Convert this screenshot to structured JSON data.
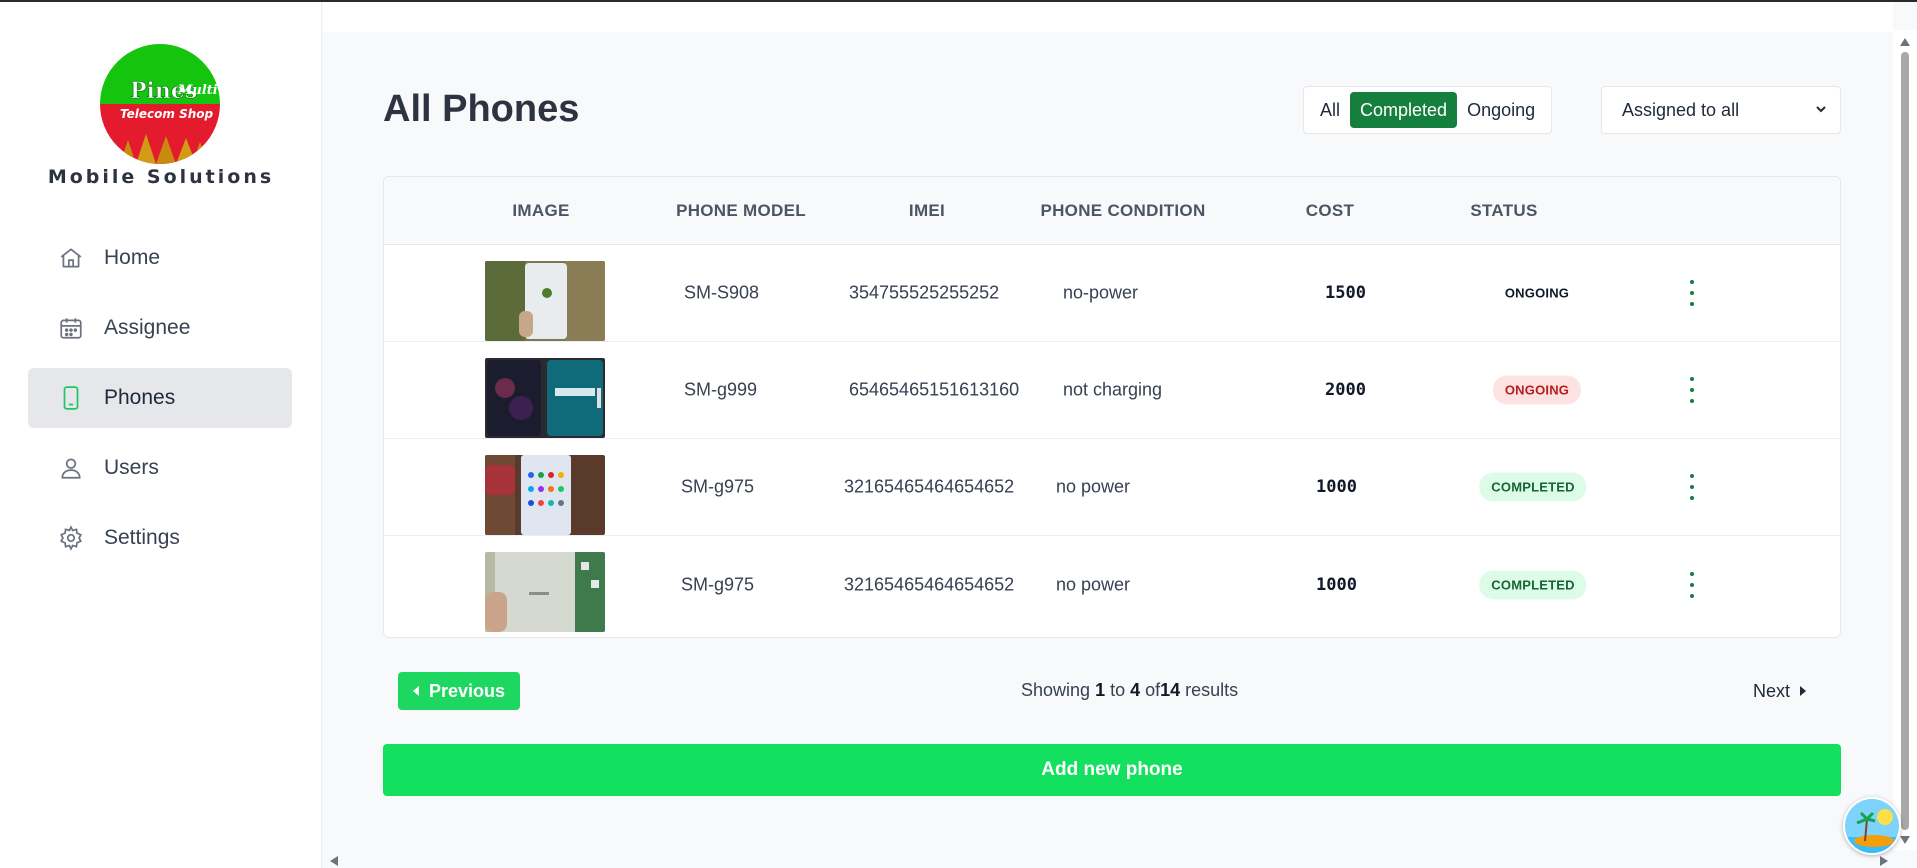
{
  "brand": {
    "logo_text_main": "Pines",
    "logo_text_script": "Multi",
    "logo_text_sub": "Telecom Shop",
    "name": "Mobile Solutions"
  },
  "sidebar": {
    "items": [
      {
        "label": "Home",
        "icon": "home-icon",
        "active": false
      },
      {
        "label": "Assignee",
        "icon": "calendar-icon",
        "active": false
      },
      {
        "label": "Phones",
        "icon": "phone-icon",
        "active": true
      },
      {
        "label": "Users",
        "icon": "user-icon",
        "active": false
      },
      {
        "label": "Settings",
        "icon": "gear-icon",
        "active": false
      }
    ]
  },
  "main": {
    "title": "All Phones",
    "filters": [
      {
        "label": "All",
        "active": false
      },
      {
        "label": "Completed",
        "active": true
      },
      {
        "label": "Ongoing",
        "active": false
      }
    ],
    "assign_select": {
      "selected": "Assigned to all"
    }
  },
  "table": {
    "headers": [
      "IMAGE",
      "PHONE MODEL",
      "IMEI",
      "PHONE CONDITION",
      "COST",
      "STATUS"
    ],
    "rows": [
      {
        "model": "SM-S908",
        "imei": "354755525255252",
        "condition": "no-power",
        "cost": "1500",
        "status": "ONGOING",
        "status_style": "plain"
      },
      {
        "model": "SM-g999",
        "imei": "65465465151613160",
        "condition": "not charging",
        "cost": "2000",
        "status": "ONGOING",
        "status_style": "ongoing"
      },
      {
        "model": "SM-g975",
        "imei": "32165465464654652",
        "condition": "no power",
        "cost": "1000",
        "status": "COMPLETED",
        "status_style": "completed"
      },
      {
        "model": "SM-g975",
        "imei": "32165465464654652",
        "condition": "no power",
        "cost": "1000",
        "status": "COMPLETED",
        "status_style": "completed"
      }
    ]
  },
  "pagination": {
    "previous_label": "Previous",
    "next_label": "Next",
    "showing_prefix": "Showing ",
    "from": "1",
    "to_word": " to ",
    "to": "4",
    "of_word": " of",
    "total": "14",
    "suffix": " results"
  },
  "actions": {
    "add_label": "Add new phone"
  },
  "colors": {
    "accent_dark_green": "#15803d",
    "accent_bright_green": "#14e060",
    "ongoing_bg": "#fde2e2",
    "ongoing_text": "#b91c1c",
    "completed_bg": "#dcfce7",
    "completed_text": "#166534"
  }
}
